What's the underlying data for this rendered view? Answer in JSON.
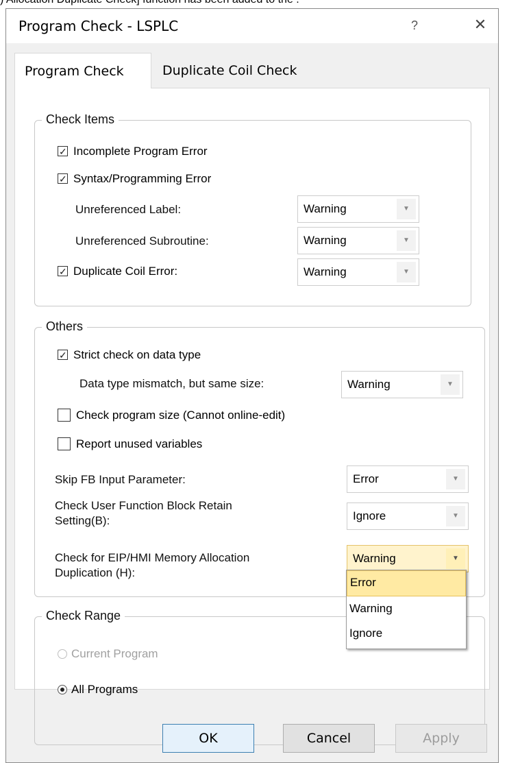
{
  "top_strip_text": ") Allocation Duplicate Check] function has been added to the .",
  "window": {
    "title": "Program Check - LSPLC",
    "help_label": "?",
    "close_label": "✕"
  },
  "tabs": [
    {
      "label": "Program Check",
      "active": true
    },
    {
      "label": "Duplicate Coil Check",
      "active": false
    }
  ],
  "check_items": {
    "legend": "Check Items",
    "incomplete_program_error": {
      "label": "Incomplete Program Error",
      "checked": true
    },
    "syntax_error": {
      "label": "Syntax/Programming Error",
      "checked": true
    },
    "unreferenced_label": {
      "label": "Unreferenced Label:",
      "value": "Warning"
    },
    "unreferenced_subroutine": {
      "label": "Unreferenced Subroutine:",
      "value": "Warning"
    },
    "duplicate_coil_error": {
      "label": "Duplicate Coil Error:",
      "checked": true,
      "value": "Warning"
    }
  },
  "others": {
    "legend": "Others",
    "strict_check": {
      "label": "Strict check on data type",
      "checked": true
    },
    "data_type_mismatch": {
      "label": "Data type mismatch, but same size:",
      "value": "Warning"
    },
    "check_program_size": {
      "label": "Check program size (Cannot online-edit)",
      "checked": false
    },
    "report_unused": {
      "label": "Report unused variables",
      "checked": false
    },
    "skip_fb_input": {
      "label": "Skip FB Input Parameter:",
      "value": "Error"
    },
    "check_ufb_retain": {
      "label_line1": "Check User Function Block Retain",
      "label_line2": "Setting(B):",
      "value": "Ignore"
    },
    "eip_hmi_dup": {
      "label_line1": "Check for EIP/HMI Memory Allocation",
      "label_line2": "Duplication (H):",
      "value": "Warning"
    }
  },
  "dropdown_options": [
    "Error",
    "Warning",
    "Ignore"
  ],
  "dropdown_highlighted": "Error",
  "check_range": {
    "legend": "Check Range",
    "current_program": {
      "label": "Current Program",
      "selected": false,
      "disabled": true
    },
    "all_programs": {
      "label": "All Programs",
      "selected": true
    }
  },
  "buttons": {
    "ok": "OK",
    "cancel": "Cancel",
    "apply": "Apply"
  }
}
